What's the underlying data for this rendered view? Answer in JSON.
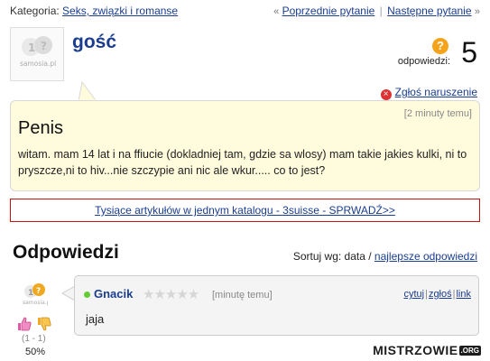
{
  "topbar": {
    "category_label": "Kategoria:",
    "category_link": "Seks, związki i romanse",
    "prev_arrow": "«",
    "prev_link": "Poprzednie pytanie",
    "separator": "|",
    "next_link": "Następne pytanie",
    "next_arrow": "»"
  },
  "asker": {
    "name": "gość",
    "logo_text": "samosia.pl"
  },
  "answers_count": {
    "label": "odpowiedzi:",
    "value": "5"
  },
  "report_label": "Zgłoś naruszenie",
  "question": {
    "title": "Penis",
    "time": "[2 minuty temu]",
    "body": "witam. mam 14 lat i na ffiucie (dokladniej tam, gdzie sa wlosy) mam takie jakies kulki, ni to pryszcze,ni to hiv...nie szczypie ani nic ale wkur..... co to jest?"
  },
  "ad_link": "Tysiące artykułów w jednym katalogu - 3suisse - SPRWADŹ>>",
  "answers_section": {
    "title": "Odpowiedzi",
    "sort_label": "Sortuj wg: data /",
    "sort_link": "najlepsze odpowiedzi"
  },
  "answer": {
    "author": "Gnacik",
    "stars": "★★★★★",
    "time": "[minutę temu]",
    "actions": [
      "cytuj",
      "zgłoś",
      "link"
    ],
    "text": "jaja",
    "votes": "(1 - 1)",
    "percent": "50%"
  },
  "watermark": {
    "text": "MISTRZOWIE",
    "suffix": ".ORG"
  },
  "colors": {
    "link": "#1a3d8f",
    "question_bg": "#fffbdc",
    "ad_border": "#cc1111",
    "accent_orange": "#f5a31a"
  }
}
